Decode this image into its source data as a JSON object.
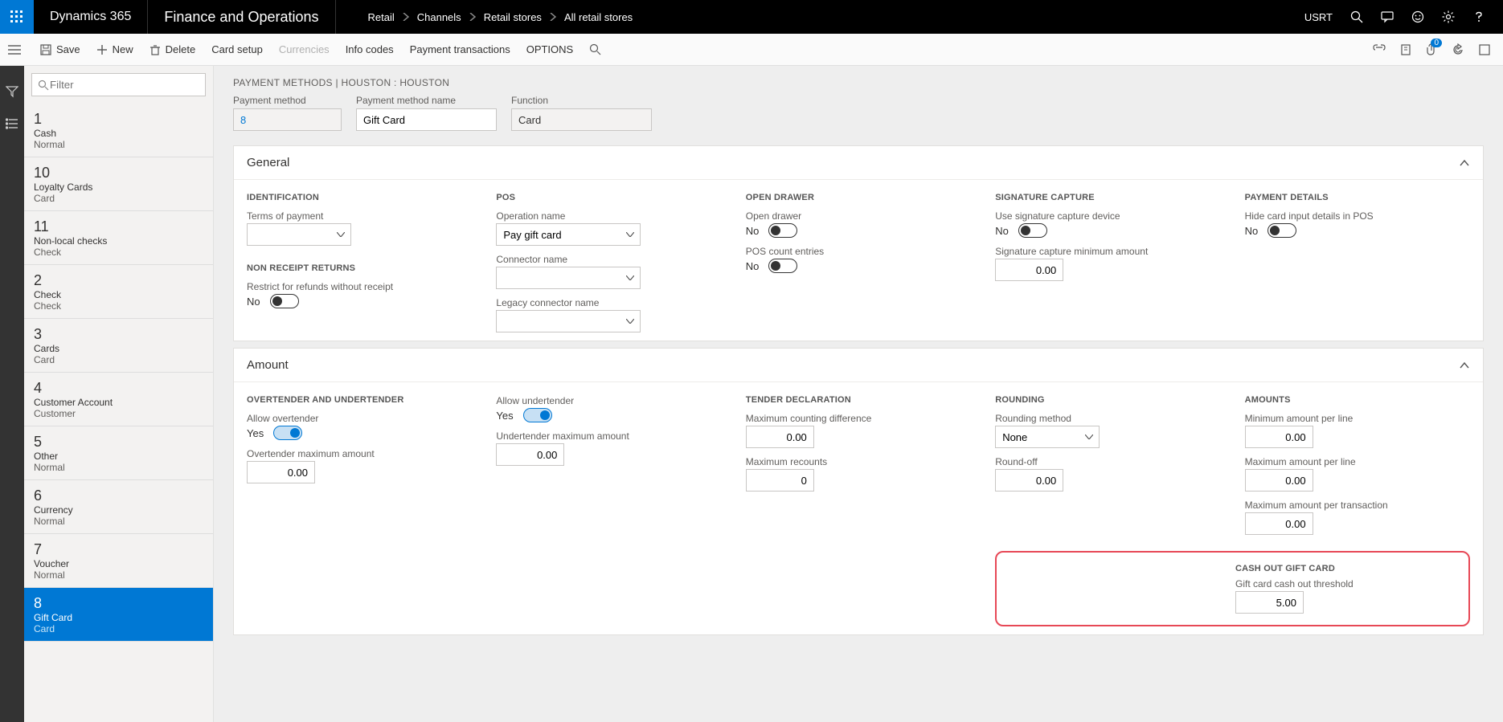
{
  "topbar": {
    "brand": "Dynamics 365",
    "module": "Finance and Operations",
    "crumbs": [
      "Retail",
      "Channels",
      "Retail stores",
      "All retail stores"
    ],
    "user": "USRT"
  },
  "cmdbar": {
    "save": "Save",
    "new": "New",
    "delete": "Delete",
    "card_setup": "Card setup",
    "currencies": "Currencies",
    "info_codes": "Info codes",
    "payment_transactions": "Payment transactions",
    "options": "OPTIONS",
    "badge_count": "0"
  },
  "filter_placeholder": "Filter",
  "list": [
    {
      "num": "1",
      "name": "Cash",
      "type": "Normal"
    },
    {
      "num": "10",
      "name": "Loyalty Cards",
      "type": "Card"
    },
    {
      "num": "11",
      "name": "Non-local checks",
      "type": "Check"
    },
    {
      "num": "2",
      "name": "Check",
      "type": "Check"
    },
    {
      "num": "3",
      "name": "Cards",
      "type": "Card"
    },
    {
      "num": "4",
      "name": "Customer Account",
      "type": "Customer"
    },
    {
      "num": "5",
      "name": "Other",
      "type": "Normal"
    },
    {
      "num": "6",
      "name": "Currency",
      "type": "Normal"
    },
    {
      "num": "7",
      "name": "Voucher",
      "type": "Normal"
    },
    {
      "num": "8",
      "name": "Gift Card",
      "type": "Card"
    }
  ],
  "header": {
    "bc": "PAYMENT METHODS   |   HOUSTON : HOUSTON",
    "fields": {
      "payment_method_lbl": "Payment method",
      "payment_method_val": "8",
      "name_lbl": "Payment method name",
      "name_val": "Gift Card",
      "function_lbl": "Function",
      "function_val": "Card"
    }
  },
  "general": {
    "title": "General",
    "identification": "IDENTIFICATION",
    "terms_lbl": "Terms of payment",
    "nonreceipt": "NON RECEIPT RETURNS",
    "restrict_lbl": "Restrict for refunds without receipt",
    "restrict_val": "No",
    "pos": "POS",
    "op_lbl": "Operation name",
    "op_val": "Pay gift card",
    "conn_lbl": "Connector name",
    "legacy_lbl": "Legacy connector name",
    "opendrawer": "OPEN DRAWER",
    "od_lbl": "Open drawer",
    "od_val": "No",
    "pcount_lbl": "POS count entries",
    "pcount_val": "No",
    "sig": "SIGNATURE CAPTURE",
    "sig_dev_lbl": "Use signature capture device",
    "sig_dev_val": "No",
    "sig_min_lbl": "Signature capture minimum amount",
    "sig_min_val": "0.00",
    "pdet": "PAYMENT DETAILS",
    "hide_lbl": "Hide card input details in POS",
    "hide_val": "No"
  },
  "amount": {
    "title": "Amount",
    "over_under": "OVERTENDER AND UNDERTENDER",
    "allow_over_lbl": "Allow overtender",
    "allow_over_val": "Yes",
    "over_max_lbl": "Overtender maximum amount",
    "over_max_val": "0.00",
    "allow_under_lbl": "Allow undertender",
    "allow_under_val": "Yes",
    "under_max_lbl": "Undertender maximum amount",
    "under_max_val": "0.00",
    "tender": "TENDER DECLARATION",
    "max_diff_lbl": "Maximum counting difference",
    "max_diff_val": "0.00",
    "max_rec_lbl": "Maximum recounts",
    "max_rec_val": "0",
    "rounding": "ROUNDING",
    "round_m_lbl": "Rounding method",
    "round_m_val": "None",
    "round_off_lbl": "Round-off",
    "round_off_val": "0.00",
    "amounts": "AMOUNTS",
    "min_line_lbl": "Minimum amount per line",
    "min_line_val": "0.00",
    "max_line_lbl": "Maximum amount per line",
    "max_line_val": "0.00",
    "max_tx_lbl": "Maximum amount per transaction",
    "max_tx_val": "0.00",
    "cashout": "CASH OUT GIFT CARD",
    "cashout_lbl": "Gift card cash out threshold",
    "cashout_val": "5.00"
  }
}
